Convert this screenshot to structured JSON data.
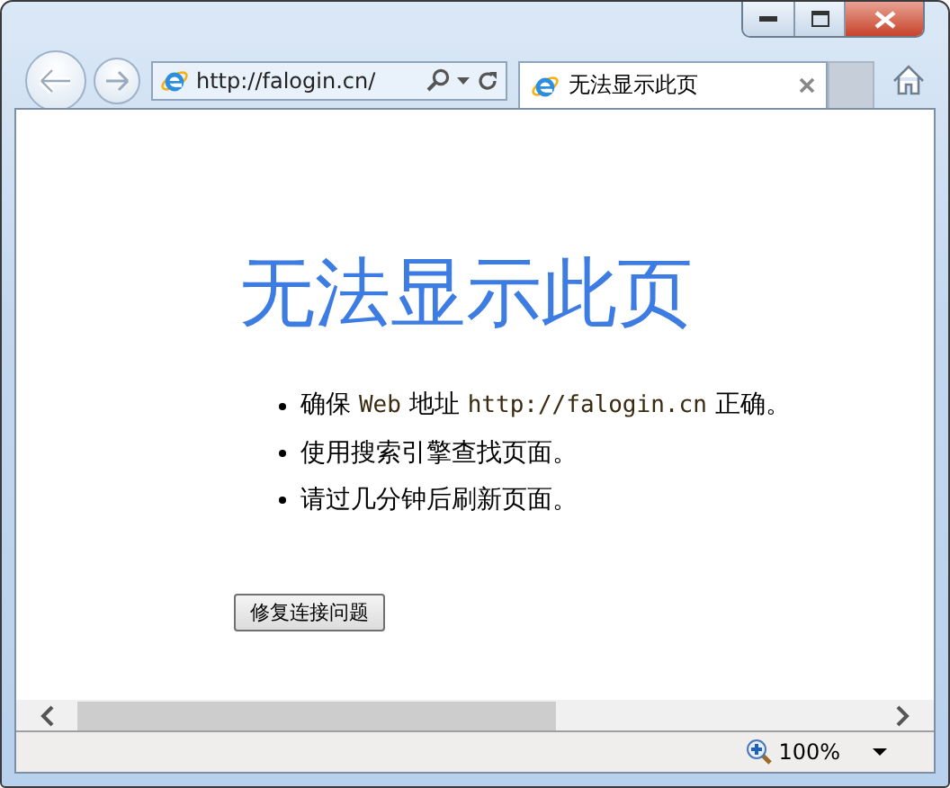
{
  "browser": {
    "address": "http://falogin.cn/",
    "tab": {
      "title": "无法显示此页",
      "selected": true
    }
  },
  "page": {
    "heading": "无法显示此页",
    "bullets": [
      [
        {
          "kind": "text",
          "text": "确保 "
        },
        {
          "kind": "code",
          "text": "Web"
        },
        {
          "kind": "text",
          "text": " 地址 "
        },
        {
          "kind": "code",
          "text": "http://falogin.cn"
        },
        {
          "kind": "text",
          "text": " 正确。"
        }
      ],
      [
        {
          "kind": "text",
          "text": "使用搜索引擎查找页面。"
        }
      ],
      [
        {
          "kind": "text",
          "text": "请过几分钟后刷新页面。"
        }
      ]
    ],
    "button": "修复连接问题"
  },
  "status_bar": {
    "zoom": "100%"
  }
}
